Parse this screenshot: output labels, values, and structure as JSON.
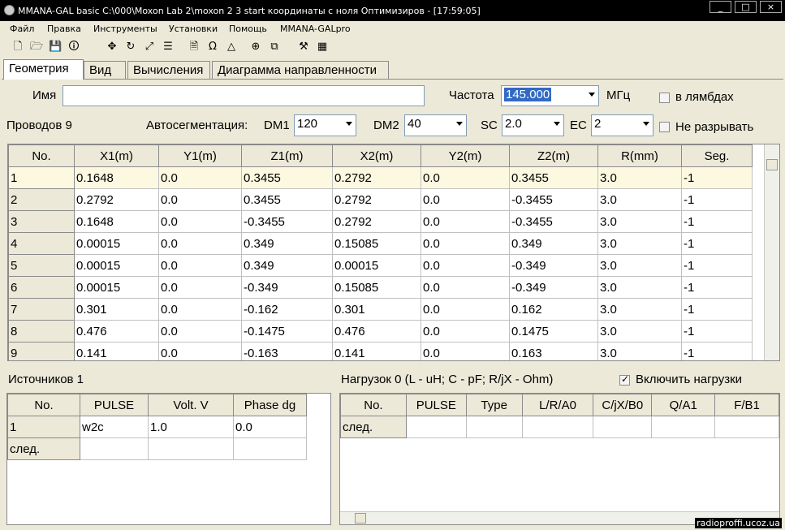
{
  "window": {
    "title": "MMANA-GAL basic C:\\000\\Moxon Lab 2\\moxon 2 3 start координаты с ноля Оптимизиров - [17:59:05]",
    "controls": [
      "_",
      "□",
      "×"
    ]
  },
  "menu": [
    "Файл",
    "Правка",
    "Инструменты",
    "Установки",
    "Помощь",
    "MMANA-GALpro"
  ],
  "toolbar": {
    "icons": [
      "new-file-icon",
      "open-folder-icon",
      "save-icon",
      "info-icon",
      "move-icon",
      "rotate-icon",
      "scale-icon",
      "stretch-icon",
      "document-icon",
      "ruler-icon",
      "triangle-icon",
      "target-icon",
      "copy-icon",
      "tools-icon",
      "calculator-icon"
    ],
    "glyphs": [
      "🗋",
      "🗁",
      "💾",
      "🛈",
      "✥",
      "↻",
      "⤢",
      "☰",
      "🗎",
      "Ω",
      "△",
      "⊕",
      "⧉",
      "⚒",
      "▦"
    ]
  },
  "tabs": [
    "Геометрия",
    "Вид",
    "Вычисления",
    "Диаграмма направленности"
  ],
  "geometry": {
    "name_label": "Имя",
    "name_value": "",
    "freq_label": "Частота",
    "freq_value": "145.000",
    "freq_unit": "МГц",
    "lambda_label": "в лямбдах",
    "lambda_checked": false,
    "wires_label": "Проводов 9",
    "autoseg_label": "Автосегментация:",
    "dm1_label": "DM1",
    "dm1_value": "120",
    "dm2_label": "DM2",
    "dm2_value": "40",
    "sc_label": "SC",
    "sc_value": "2.0",
    "ec_label": "EC",
    "ec_value": "2",
    "nobreak_label": "Не разрывать",
    "nobreak_checked": false
  },
  "wires_table": {
    "columns": [
      "No.",
      "X1(m)",
      "Y1(m)",
      "Z1(m)",
      "X2(m)",
      "Y2(m)",
      "Z2(m)",
      "R(mm)",
      "Seg."
    ],
    "rows": [
      [
        "1",
        "0.1648",
        "0.0",
        "0.3455",
        "0.2792",
        "0.0",
        "0.3455",
        "3.0",
        "-1"
      ],
      [
        "2",
        "0.2792",
        "0.0",
        "0.3455",
        "0.2792",
        "0.0",
        "-0.3455",
        "3.0",
        "-1"
      ],
      [
        "3",
        "0.1648",
        "0.0",
        "-0.3455",
        "0.2792",
        "0.0",
        "-0.3455",
        "3.0",
        "-1"
      ],
      [
        "4",
        "0.00015",
        "0.0",
        "0.349",
        "0.15085",
        "0.0",
        "0.349",
        "3.0",
        "-1"
      ],
      [
        "5",
        "0.00015",
        "0.0",
        "0.349",
        "0.00015",
        "0.0",
        "-0.349",
        "3.0",
        "-1"
      ],
      [
        "6",
        "0.00015",
        "0.0",
        "-0.349",
        "0.15085",
        "0.0",
        "-0.349",
        "3.0",
        "-1"
      ],
      [
        "7",
        "0.301",
        "0.0",
        "-0.162",
        "0.301",
        "0.0",
        "0.162",
        "3.0",
        "-1"
      ],
      [
        "8",
        "0.476",
        "0.0",
        "-0.1475",
        "0.476",
        "0.0",
        "0.1475",
        "3.0",
        "-1"
      ],
      [
        "9",
        "0.141",
        "0.0",
        "-0.163",
        "0.141",
        "0.0",
        "0.163",
        "3.0",
        "-1"
      ]
    ]
  },
  "sources": {
    "label": "Источников 1",
    "columns": [
      "No.",
      "PULSE",
      "Volt. V",
      "Phase dg"
    ],
    "rows": [
      [
        "1",
        "w2c",
        "1.0",
        "0.0"
      ],
      [
        "след.",
        "",
        "",
        ""
      ]
    ]
  },
  "loads": {
    "label": "Нагрузок 0 (L - uH; C - pF; R/jX - Ohm)",
    "enable_label": "Включить нагрузки",
    "enable_checked": true,
    "columns": [
      "No.",
      "PULSE",
      "Type",
      "L/R/A0",
      "C/jX/B0",
      "Q/A1",
      "F/B1"
    ],
    "rows": [
      [
        "след.",
        "",
        "",
        "",
        "",
        "",
        ""
      ]
    ]
  },
  "watermark": "radioproffi.ucoz.ua"
}
